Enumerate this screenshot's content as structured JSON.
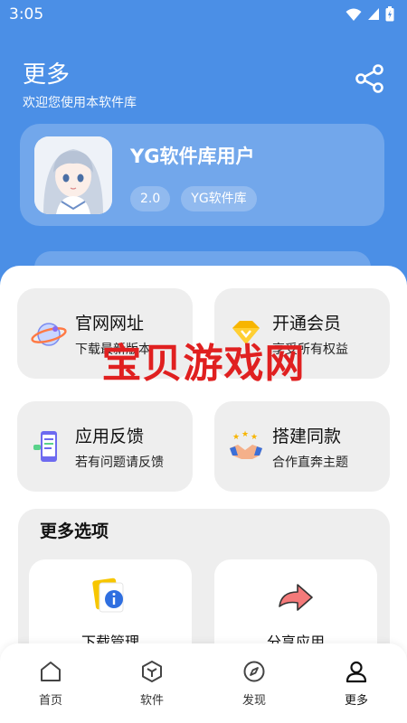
{
  "status_bar": {
    "time": "3:05"
  },
  "header": {
    "title": "更多",
    "subtitle": "欢迎您使用本软件库",
    "share_icon": "share-icon"
  },
  "profile": {
    "name": "YG软件库用户",
    "chips": [
      "2.0",
      "YG软件库"
    ]
  },
  "tiles": [
    {
      "title": "官网网址",
      "subtitle": "下载最新版本",
      "icon": "globe-planet-icon"
    },
    {
      "title": "开通会员",
      "subtitle": "享受所有权益",
      "icon": "vip-diamond-icon"
    },
    {
      "title": "应用反馈",
      "subtitle": "若有问题请反馈",
      "icon": "phone-feedback-icon"
    },
    {
      "title": "搭建同款",
      "subtitle": "合作直奔主题",
      "icon": "handshake-icon"
    }
  ],
  "more_options": {
    "title": "更多选项",
    "items": [
      {
        "label": "下载管理",
        "icon": "download-info-icon"
      },
      {
        "label": "分享应用",
        "icon": "share-arrow-icon"
      }
    ]
  },
  "tabbar": [
    {
      "label": "首页",
      "icon": "home-icon"
    },
    {
      "label": "软件",
      "icon": "box-icon"
    },
    {
      "label": "发现",
      "icon": "compass-icon"
    },
    {
      "label": "更多",
      "icon": "user-icon"
    }
  ],
  "watermark": "宝贝游戏网",
  "colors": {
    "primary": "#4b8fe6",
    "watermark": "#e02020",
    "tile_bg": "#eeeeee"
  }
}
